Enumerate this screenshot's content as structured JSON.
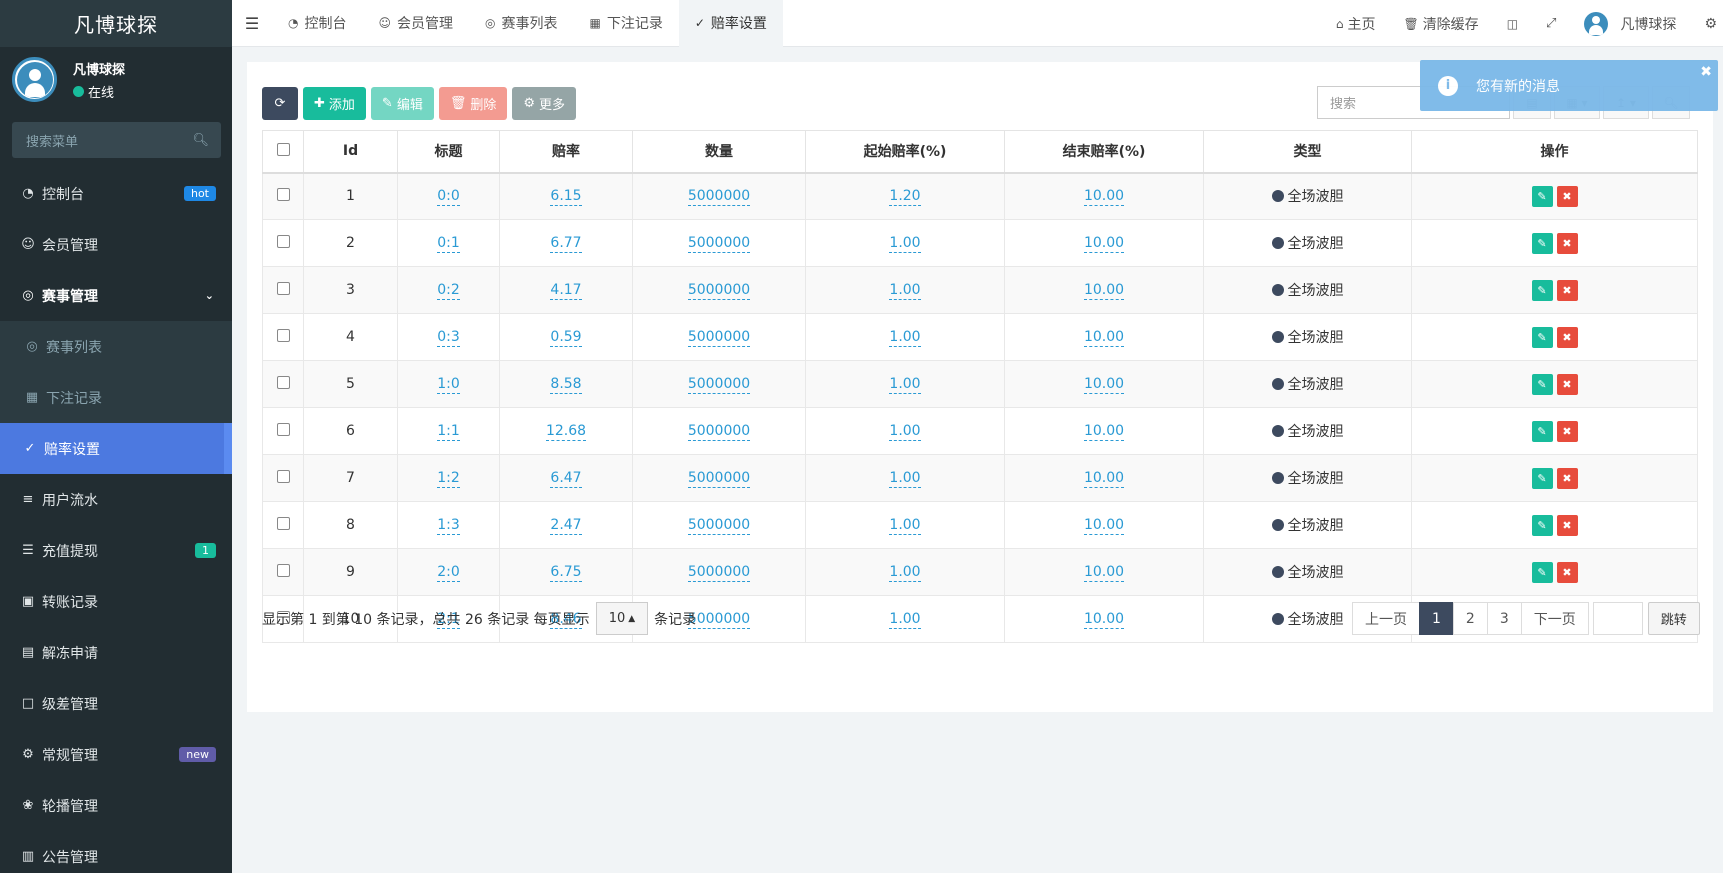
{
  "brand": "凡博球探",
  "user": {
    "name": "凡博球探",
    "status": "在线"
  },
  "menu_search": {
    "placeholder": "搜索菜单"
  },
  "menu": [
    {
      "label": "控制台",
      "icon": "dashboard-icon",
      "badge": "hot"
    },
    {
      "label": "会员管理",
      "icon": "users-icon"
    },
    {
      "label": "赛事管理",
      "icon": "lifebuoy-icon"
    },
    {
      "label": "赛事列表",
      "icon": "lifebuoy-icon"
    },
    {
      "label": "下注记录",
      "icon": "calendar-icon"
    },
    {
      "label": "赔率设置",
      "icon": "vk-icon"
    },
    {
      "label": "用户流水",
      "icon": "list-icon"
    },
    {
      "label": "充值提现",
      "icon": "indent-icon",
      "badge": "1"
    },
    {
      "label": "转账记录",
      "icon": "translate-icon"
    },
    {
      "label": "解冻申请",
      "icon": "image-icon"
    },
    {
      "label": "级差管理",
      "icon": "window-icon"
    },
    {
      "label": "常规管理",
      "icon": "gears-icon",
      "badge": "new"
    },
    {
      "label": "轮播管理",
      "icon": "balloon-icon"
    },
    {
      "label": "公告管理",
      "icon": "newspaper-icon"
    }
  ],
  "tabs": [
    {
      "label": "控制台",
      "icon": "dashboard-icon"
    },
    {
      "label": "会员管理",
      "icon": "users-icon"
    },
    {
      "label": "赛事列表",
      "icon": "lifebuoy-icon"
    },
    {
      "label": "下注记录",
      "icon": "calendar-icon"
    },
    {
      "label": "赔率设置",
      "icon": "vk-icon"
    }
  ],
  "nav_right": {
    "home": "主页",
    "clear_cache": "清除缓存",
    "username": "凡博球探"
  },
  "toolbar": {
    "add": "添加",
    "edit": "编辑",
    "delete": "删除",
    "more": "更多"
  },
  "search": {
    "placeholder": "搜索"
  },
  "notification": "您有新的消息",
  "table": {
    "headers": [
      "Id",
      "标题",
      "赔率",
      "数量",
      "起始赔率(%)",
      "结束赔率(%)",
      "类型",
      "操作"
    ],
    "rows": [
      {
        "id": "1",
        "title": "0:0",
        "odds": "6.15",
        "qty": "5000000",
        "start": "1.20",
        "end": "10.00",
        "type": "全场波胆"
      },
      {
        "id": "2",
        "title": "0:1",
        "odds": "6.77",
        "qty": "5000000",
        "start": "1.00",
        "end": "10.00",
        "type": "全场波胆"
      },
      {
        "id": "3",
        "title": "0:2",
        "odds": "4.17",
        "qty": "5000000",
        "start": "1.00",
        "end": "10.00",
        "type": "全场波胆"
      },
      {
        "id": "4",
        "title": "0:3",
        "odds": "0.59",
        "qty": "5000000",
        "start": "1.00",
        "end": "10.00",
        "type": "全场波胆"
      },
      {
        "id": "5",
        "title": "1:0",
        "odds": "8.58",
        "qty": "5000000",
        "start": "1.00",
        "end": "10.00",
        "type": "全场波胆"
      },
      {
        "id": "6",
        "title": "1:1",
        "odds": "12.68",
        "qty": "5000000",
        "start": "1.00",
        "end": "10.00",
        "type": "全场波胆"
      },
      {
        "id": "7",
        "title": "1:2",
        "odds": "6.47",
        "qty": "5000000",
        "start": "1.00",
        "end": "10.00",
        "type": "全场波胆"
      },
      {
        "id": "8",
        "title": "1:3",
        "odds": "2.47",
        "qty": "5000000",
        "start": "1.00",
        "end": "10.00",
        "type": "全场波胆"
      },
      {
        "id": "9",
        "title": "2:0",
        "odds": "6.75",
        "qty": "5000000",
        "start": "1.00",
        "end": "10.00",
        "type": "全场波胆"
      },
      {
        "id": "10",
        "title": "2:1",
        "odds": "8.46",
        "qty": "5000000",
        "start": "1.00",
        "end": "10.00",
        "type": "全场波胆"
      }
    ]
  },
  "footer": {
    "info_prefix": "显示第 1 到第 10 条记录，总共 26 条记录 每页显示",
    "page_size": "10",
    "info_suffix": "条记录",
    "prev": "上一页",
    "pages": [
      "1",
      "2",
      "3"
    ],
    "next": "下一页",
    "jump": "跳转"
  }
}
